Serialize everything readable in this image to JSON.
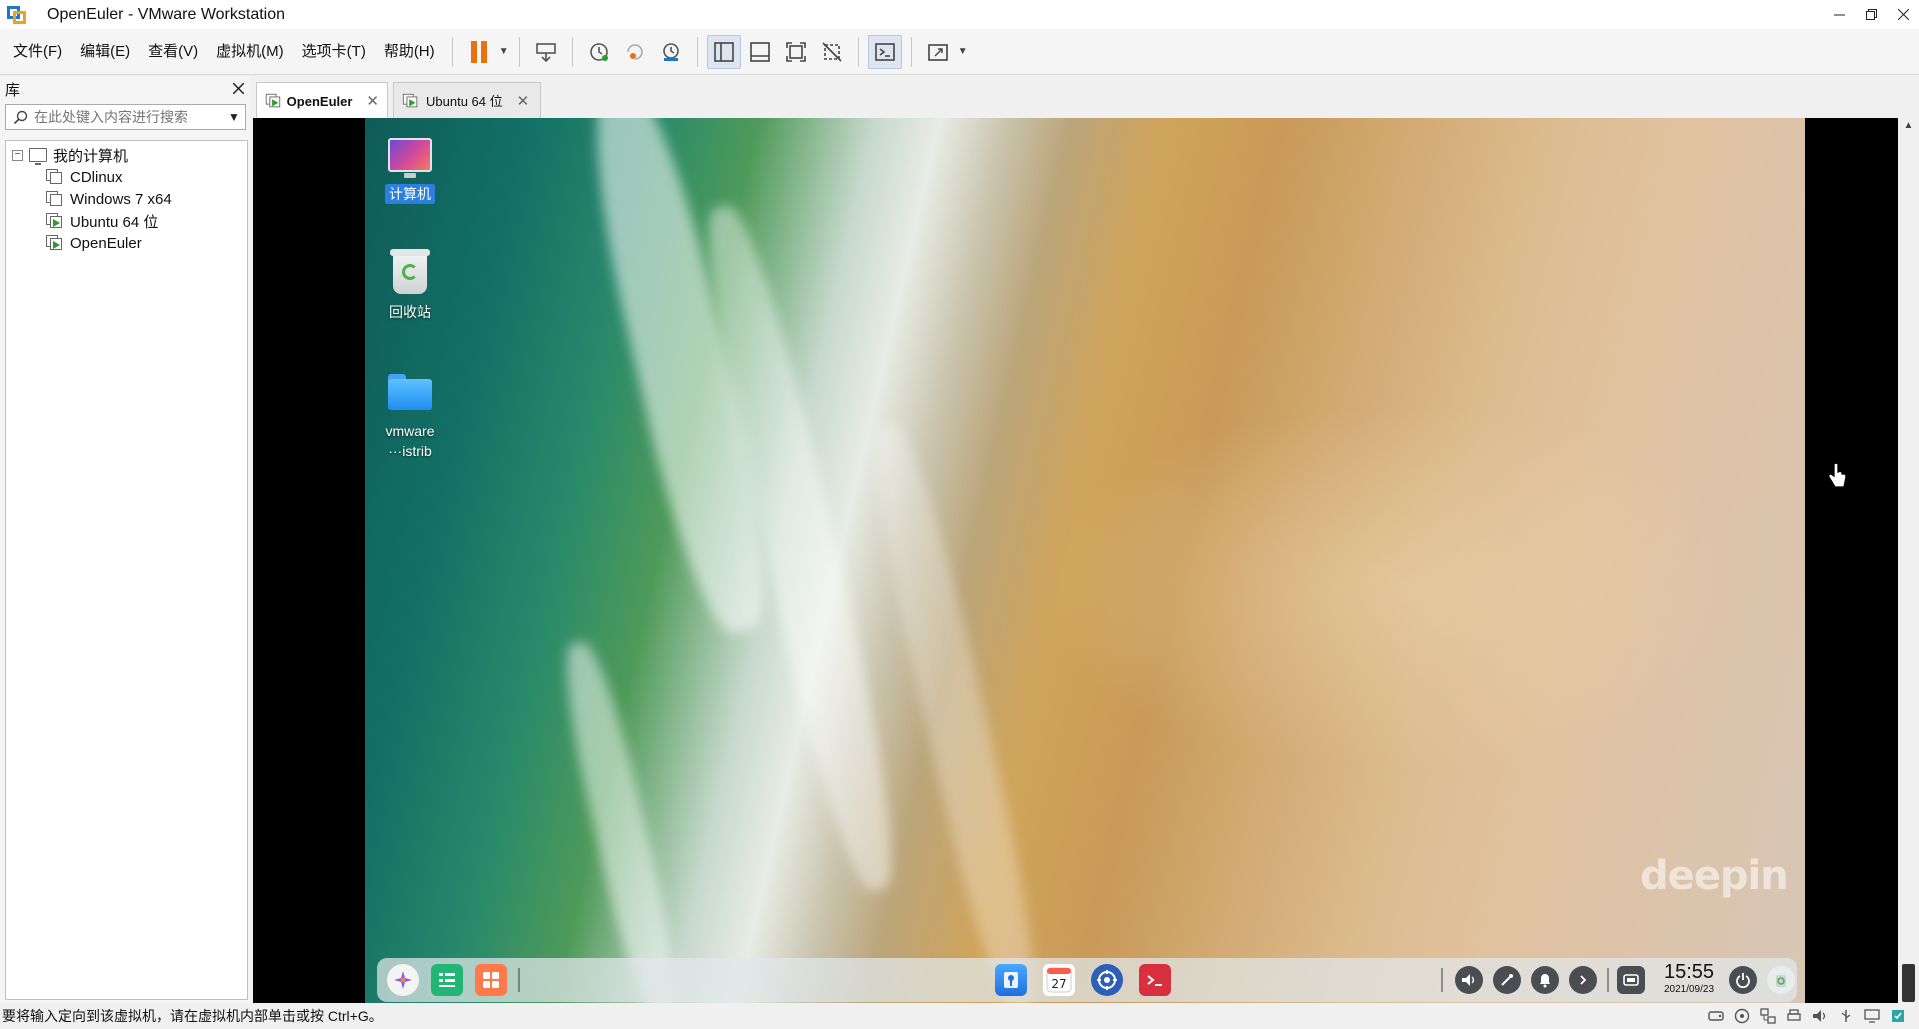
{
  "window": {
    "title": "OpenEuler - VMware Workstation"
  },
  "menu": [
    "文件(F)",
    "编辑(E)",
    "查看(V)",
    "虚拟机(M)",
    "选项卡(T)",
    "帮助(H)"
  ],
  "library": {
    "title": "库",
    "search_placeholder": "在此处键入内容进行搜索",
    "root": "我的计算机",
    "vms": [
      "CDlinux",
      "Windows 7 x64",
      "Ubuntu 64 位",
      "OpenEuler"
    ]
  },
  "tabs": [
    {
      "label": "OpenEuler",
      "active": true
    },
    {
      "label": "Ubuntu 64 位",
      "active": false
    }
  ],
  "desktop": {
    "icons": [
      {
        "label": "计算机",
        "icon": "computer-icon",
        "selected": true
      },
      {
        "label": "回收站",
        "icon": "trash-icon",
        "selected": false
      },
      {
        "label": "vmware",
        "label2": "···istrib",
        "icon": "folder-icon",
        "selected": false
      }
    ],
    "watermark": "deepin",
    "dock_apps": [
      "launcher-icon",
      "file-manager-icon",
      "app-store-icon",
      "browser-icon",
      "calendar-icon",
      "settings-icon",
      "terminal-icon"
    ],
    "calendar_day": "27",
    "tray": [
      "volume-icon",
      "pen-icon",
      "notification-icon",
      "expand-icon",
      "multitask-icon",
      "power-icon",
      "dock-trash-icon"
    ],
    "clock": {
      "time": "15:55",
      "date": "2021/09/23"
    }
  },
  "statusbar": {
    "message": "要将输入定向到该虚拟机，请在虚拟机内部单击或按 Ctrl+G。"
  },
  "colors": {
    "accent": "#e8720c",
    "selection": "#2b7fe0",
    "vm_play": "#2a9d2a"
  }
}
